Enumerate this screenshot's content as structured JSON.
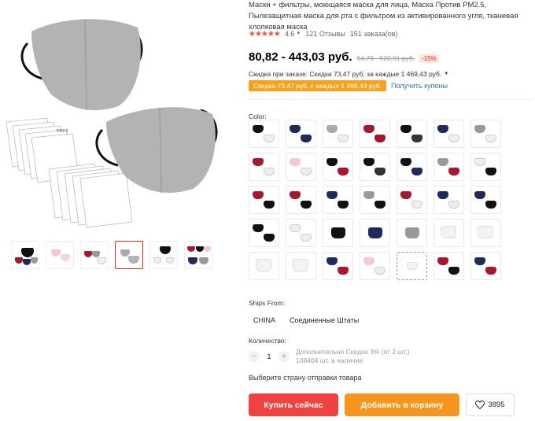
{
  "product": {
    "title": "Маски + фильтры, моющаяся маска для лица, Маска Против PM2.5, Пылезащитная маска для рта с фильтром из активированного угля, тканевая хлопковая маска",
    "rating": {
      "stars": "★★★★★",
      "value": "4.6",
      "reviews": "121 Отзывы",
      "orders": "151 заказа(ов)"
    },
    "price": "80,82 - 443,03 руб.",
    "old_price": "94,78 - 520,91 руб.",
    "discount": "-15%",
    "order_discount": "Скидка при заказе: Скидка 73,47 руб. за каждые 1 469,43 руб.",
    "coupon_badge": "Скидка 73,47 руб. с каждых 1 469,43 руб.",
    "coupon_link": "Получить купоны",
    "filter_label": "PM2.5"
  },
  "color": {
    "label": "Color:"
  },
  "ships": {
    "label": "Ships From:",
    "options": [
      "CHINA",
      "Соединенные Штаты"
    ]
  },
  "quantity": {
    "label": "Количество:",
    "value": "1",
    "minus": "−",
    "plus": "+",
    "extra_discount": "Дополнительно Скидка 3% (от 2 шт.)",
    "stock": "108404 шт. в наличии"
  },
  "ship_country": "Выберите страну отправки товара",
  "actions": {
    "buy": "Купить сейчас",
    "cart": "Добавить в корзину",
    "wish_count": "3895"
  },
  "colors": {
    "accent": "#e62e04",
    "buy": "#f0423f",
    "cart": "#f7961f",
    "coupon": "#f7a21c",
    "link": "#2a6fd6"
  }
}
